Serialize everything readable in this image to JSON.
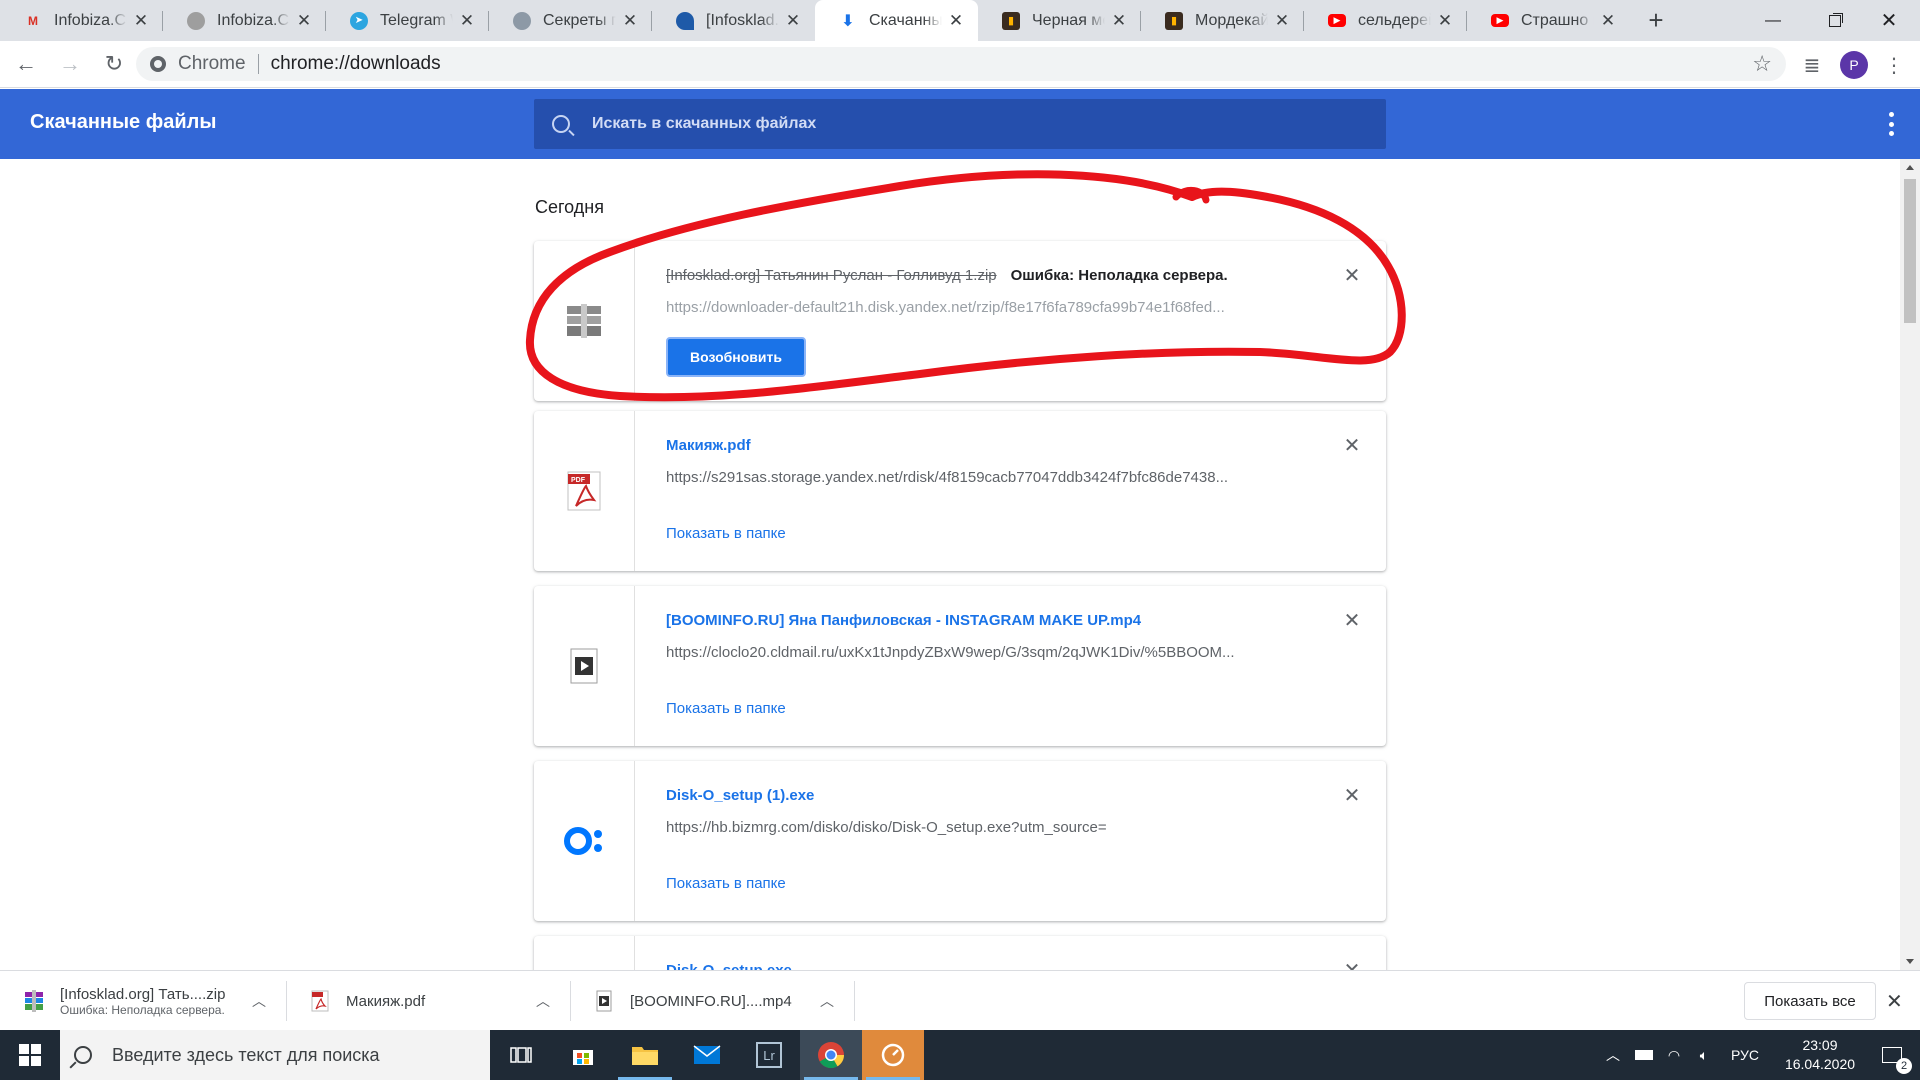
{
  "browser": {
    "tabs": [
      {
        "title": "Infobiza.Com",
        "icon": "gmail-icon",
        "active": false
      },
      {
        "title": "Infobiza.Com",
        "icon": "person-icon",
        "active": false
      },
      {
        "title": "Telegram Web",
        "icon": "telegram-icon",
        "active": false
      },
      {
        "title": "Секреты парикмахера",
        "icon": "globe-icon",
        "active": false
      },
      {
        "title": "[Infosklad.org]",
        "icon": "infosklad-icon",
        "active": false
      },
      {
        "title": "Скачанные файлы",
        "icon": "download-icon",
        "active": true
      },
      {
        "title": "Черная месса",
        "icon": "kinopoisk-icon",
        "active": false
      },
      {
        "title": "Мордекай",
        "icon": "kinopoisk-icon",
        "active": false
      },
      {
        "title": "сельдерей для",
        "icon": "youtube-icon",
        "active": false
      },
      {
        "title": "Страшно подумать",
        "icon": "youtube-icon",
        "active": false
      }
    ],
    "omnibox": {
      "scheme": "Chrome",
      "url": "chrome://downloads"
    },
    "profile_initial": "P"
  },
  "downloads_page": {
    "title": "Скачанные файлы",
    "search_placeholder": "Искать в скачанных файлах",
    "section_label": "Сегодня",
    "items": [
      {
        "name": "[Infosklad.org] Татьянин Руслан - Голливуд 1.zip",
        "status": "Ошибка: Неполадка сервера.",
        "url": "https://downloader-default21h.disk.yandex.net/rzip/f8e17f6fa789cfa99b74e1f68fed...",
        "action": "Возобновить",
        "icon": "zip-archive-icon",
        "failed": true
      },
      {
        "name": "Макияж.pdf",
        "url": "https://s291sas.storage.yandex.net/rdisk/4f8159cacb77047ddb3424f7bfc86de7438...",
        "action": "Показать в папке",
        "icon": "pdf-icon",
        "failed": false
      },
      {
        "name": "[BOOMINFO.RU] Яна Панфиловская - INSTAGRAM MAKE UP.mp4",
        "url": "https://cloclo20.cldmail.ru/uxKx1tJnpdyZBxW9wep/G/3sqm/2qJWK1Div/%5BBOOM...",
        "action": "Показать в папке",
        "icon": "video-file-icon",
        "failed": false
      },
      {
        "name": "Disk-O_setup (1).exe",
        "url": "https://hb.bizmrg.com/disko/disko/Disk-O_setup.exe?utm_source=",
        "action": "Показать в папке",
        "icon": "disk-o-icon",
        "failed": false
      },
      {
        "name": "Disk-O_setup.exe",
        "url": "",
        "action": "",
        "icon": "disk-o-icon",
        "failed": false
      }
    ]
  },
  "download_shelf": {
    "items": [
      {
        "name": "[Infosklad.org] Тать....zip",
        "status": "Ошибка: Неполадка сервера.",
        "icon": "zip-archive-icon"
      },
      {
        "name": "Макияж.pdf",
        "status": "",
        "icon": "pdf-icon"
      },
      {
        "name": "[BOOMINFO.RU]....mp4",
        "status": "",
        "icon": "video-file-icon"
      }
    ],
    "show_all_label": "Показать все"
  },
  "taskbar": {
    "search_placeholder": "Введите здесь текст для поиска",
    "apps": [
      "task-view-icon",
      "store-icon",
      "file-explorer-icon",
      "mail-icon",
      "lightroom-icon",
      "chrome-icon",
      "clock-app-icon"
    ],
    "language": "РУС",
    "time": "23:09",
    "date": "16.04.2020",
    "notifications": "2"
  },
  "colors": {
    "header_blue": "#3367d6",
    "link_blue": "#1a73e8",
    "annotation_red": "#e8141b"
  }
}
